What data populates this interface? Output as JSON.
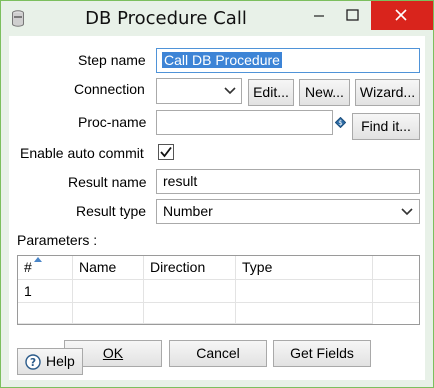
{
  "window": {
    "title": "DB Procedure Call",
    "controls": {
      "minimize": "minimize",
      "maximize": "maximize",
      "close": "close"
    }
  },
  "form": {
    "step_name": {
      "label": "Step name",
      "value": "Call DB Procedure"
    },
    "connection": {
      "label": "Connection",
      "value": "",
      "edit": "Edit...",
      "new": "New...",
      "wizard": "Wizard..."
    },
    "proc_name": {
      "label": "Proc-name",
      "value": "",
      "find": "Find it..."
    },
    "auto_commit": {
      "label": "Enable auto commit",
      "checked": true
    },
    "result_name": {
      "label": "Result name",
      "value": "result"
    },
    "result_type": {
      "label": "Result type",
      "value": "Number"
    }
  },
  "parameters": {
    "label": "Parameters :",
    "columns": [
      "#",
      "Name",
      "Direction",
      "Type"
    ],
    "rows": [
      {
        "num": "1",
        "name": "",
        "direction": "",
        "type": ""
      }
    ]
  },
  "buttons": {
    "ok": "OK",
    "cancel": "Cancel",
    "get_fields": "Get Fields",
    "help": "Help"
  },
  "colors": {
    "accent_border": "#7cbf5e",
    "close": "#d9241c",
    "selection": "#3d84d6"
  }
}
